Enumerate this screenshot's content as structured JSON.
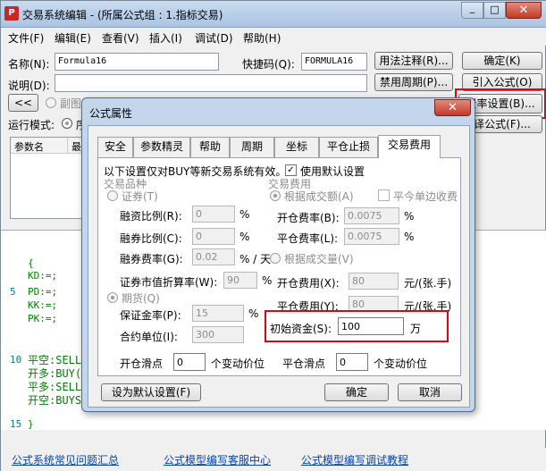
{
  "window": {
    "title": "交易系统编辑 - (所属公式组 : 1.指标交易)",
    "app_icon_text": "P",
    "min_glyph": "_",
    "max_glyph": "□",
    "close_glyph": "✕"
  },
  "menu": [
    "文件(F)",
    "编辑(E)",
    "查看(V)",
    "插入(I)",
    "调试(D)",
    "帮助(H)"
  ],
  "form": {
    "name_label": "名称(N):",
    "name_value": "Formula16",
    "shortcut_label": "快捷码(Q):",
    "shortcut_value": "FORMULA16",
    "desc_label": "说明(D):",
    "desc_value": "",
    "collapse_label": "<<",
    "partial_radio_label": "副图",
    "run_mode_label": "运行模式:",
    "run_mode_value": "序",
    "param_col1": "参数名",
    "param_col2": "最"
  },
  "right_buttons": {
    "usage": "用法注释(R)...",
    "ok": "确定(K)",
    "disable_period": "禁用周期(P)...",
    "import": "引入公式(O)",
    "fee_settings": "费率设置(B)...",
    "other": "译公式(F)..."
  },
  "code_lines": [
    {
      "ln": "",
      "text": "{",
      "color": "#008000"
    },
    {
      "ln": "",
      "text": "KD:=;",
      "color": "#008000"
    },
    {
      "ln": "5",
      "text": "PD:=;",
      "color": "#008000"
    },
    {
      "ln": "",
      "text": "KK:=;",
      "color": "#008000"
    },
    {
      "ln": "",
      "text": "PK:=;",
      "color": "#008000"
    },
    {
      "ln": "10",
      "text": "平空:SELL",
      "color": "#008000"
    },
    {
      "ln": "",
      "text": "开多:BUY(",
      "color": "#008000"
    },
    {
      "ln": "",
      "text": "平多:SELL",
      "color": "#008000"
    },
    {
      "ln": "",
      "text": "开空:BUYS",
      "color": "#008000"
    },
    {
      "ln": "15",
      "text": "}",
      "color": "#008000"
    }
  ],
  "bottom_links": [
    "公式系统常见问题汇总",
    "公式模型编写客服中心",
    "公式模型编写调试教程"
  ],
  "dialog": {
    "title": "公式属性",
    "close_glyph": "✕",
    "tabs": [
      "安全",
      "参数精灵",
      "帮助",
      "周期",
      "坐标",
      "平仓止损",
      "交易费用"
    ],
    "active_tab": 6,
    "notice": "以下设置仅对BUY等新交易系统有效。",
    "use_default_label": "使用默认设置",
    "use_default_checked": "✓",
    "product_group": "交易品种",
    "stock_radio": "证券(T)",
    "finance_ratio_label": "融资比例(R):",
    "finance_ratio": "0",
    "securities_ratio_label": "融券比例(C):",
    "securities_ratio": "0",
    "securities_fee_label": "融券费率(G):",
    "securities_fee": "0.02",
    "pct": "%",
    "pct_per_day": "% / 天",
    "discount_label": "证券市值折算率(W):",
    "discount": "90",
    "futures_radio": "期货(Q)",
    "margin_label": "保证金率(P):",
    "margin": "15",
    "contract_unit_label": "合约单位(I):",
    "contract_unit": "300",
    "fee_group": "交易费用",
    "by_amount_radio": "根据成交额(A)",
    "close_single_label": "平今单边收费",
    "open_rate_label": "开仓费率(B):",
    "open_rate": "0.0075",
    "close_rate_label": "平仓费率(L):",
    "close_rate": "0.0075",
    "by_volume_radio": "根据成交量(V)",
    "open_fee_label": "开仓费用(X):",
    "open_fee": "80",
    "close_fee_label": "平仓费用(Y):",
    "close_fee": "80",
    "fee_unit": "元/(张.手)",
    "init_capital_label": "初始资金(S):",
    "init_capital": "100",
    "init_capital_unit": "万",
    "open_slip_label": "开仓滑点",
    "open_slip": "0",
    "close_slip_label": "平仓滑点",
    "close_slip": "0",
    "tick_unit": "个变动价位",
    "set_default_button": "设为默认设置(F)",
    "ok_button": "确定",
    "cancel_button": "取消"
  },
  "colors": {
    "highlight_red": "#e50012",
    "title_blue": "#aac4e2",
    "code_green": "#008000",
    "link_blue": "#0645ad"
  }
}
